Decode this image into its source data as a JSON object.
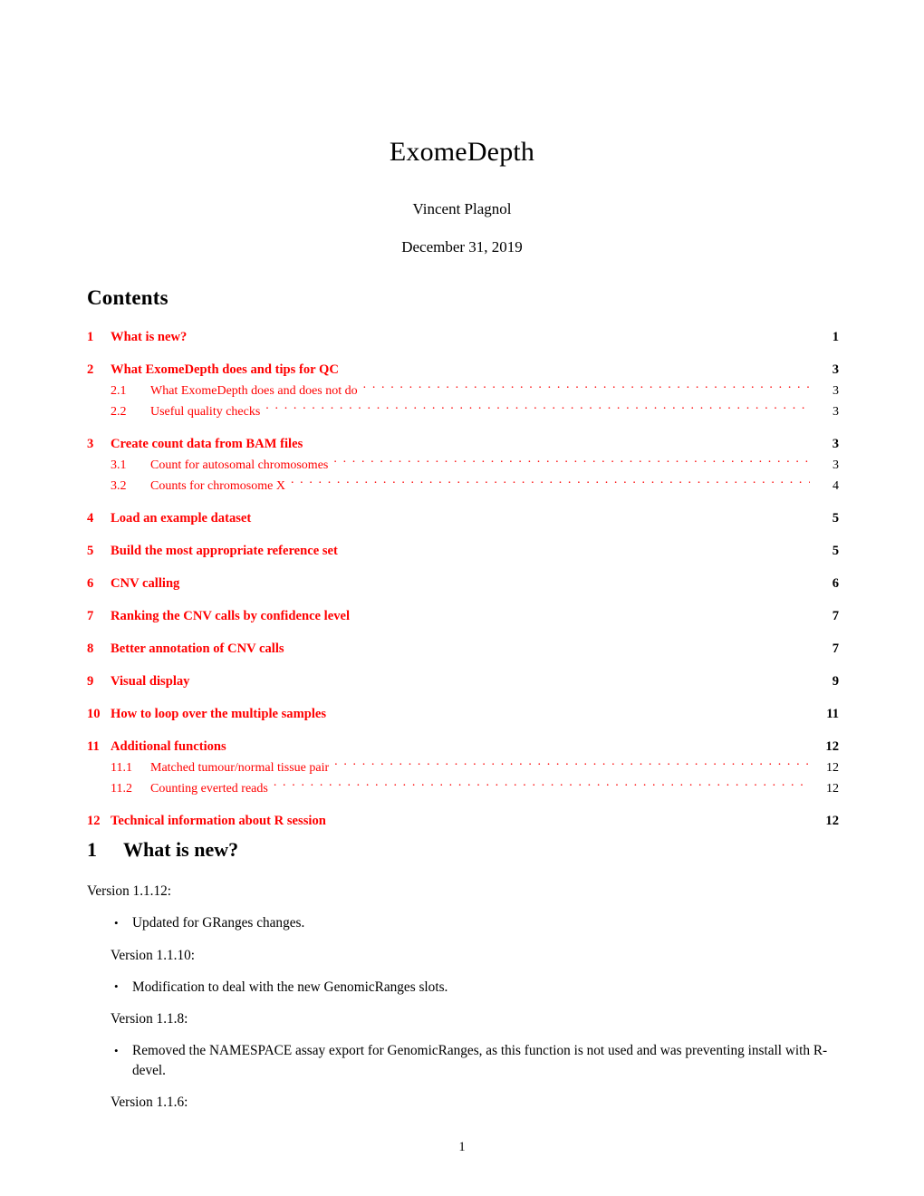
{
  "document": {
    "title": "ExomeDepth",
    "author": "Vincent Plagnol",
    "date": "December 31, 2019",
    "page_number": "1",
    "link_color": "#ff0000",
    "text_color": "#000000"
  },
  "contents": {
    "heading": "Contents",
    "entries": [
      {
        "level": 1,
        "number": "1",
        "label": "What is new?",
        "page": "1"
      },
      {
        "level": 1,
        "number": "2",
        "label": "What ExomeDepth does and tips for QC",
        "page": "3"
      },
      {
        "level": 2,
        "number": "2.1",
        "label": "What ExomeDepth does and does not do",
        "page": "3"
      },
      {
        "level": 2,
        "number": "2.2",
        "label": "Useful quality checks",
        "page": "3"
      },
      {
        "level": 1,
        "number": "3",
        "label": "Create count data from BAM files",
        "page": "3"
      },
      {
        "level": 2,
        "number": "3.1",
        "label": "Count for autosomal chromosomes",
        "page": "3"
      },
      {
        "level": 2,
        "number": "3.2",
        "label": "Counts for chromosome X",
        "page": "4"
      },
      {
        "level": 1,
        "number": "4",
        "label": "Load an example dataset",
        "page": "5"
      },
      {
        "level": 1,
        "number": "5",
        "label": "Build the most appropriate reference set",
        "page": "5"
      },
      {
        "level": 1,
        "number": "6",
        "label": "CNV calling",
        "page": "6"
      },
      {
        "level": 1,
        "number": "7",
        "label": "Ranking the CNV calls by confidence level",
        "page": "7"
      },
      {
        "level": 1,
        "number": "8",
        "label": "Better annotation of CNV calls",
        "page": "7"
      },
      {
        "level": 1,
        "number": "9",
        "label": "Visual display",
        "page": "9"
      },
      {
        "level": 1,
        "number": "10",
        "label": "How to loop over the multiple samples",
        "page": "11"
      },
      {
        "level": 1,
        "number": "11",
        "label": "Additional functions",
        "page": "12"
      },
      {
        "level": 2,
        "number": "11.1",
        "label": "Matched tumour/normal tissue pair",
        "page": "12"
      },
      {
        "level": 2,
        "number": "11.2",
        "label": "Counting everted reads",
        "page": "12"
      },
      {
        "level": 1,
        "number": "12",
        "label": "Technical information about R session",
        "page": "12"
      }
    ]
  },
  "section1": {
    "number": "1",
    "title": "What is new?",
    "blocks": [
      {
        "version": "Version 1.1.12:",
        "bullets": [
          "Updated for GRanges changes."
        ]
      },
      {
        "version": "Version 1.1.10:",
        "bullets": [
          "Modification to deal with the new GenomicRanges slots."
        ]
      },
      {
        "version": "Version 1.1.8:",
        "bullets": [
          "Removed the NAMESPACE assay export for GenomicRanges, as this function is not used and was preventing install with R-devel."
        ]
      },
      {
        "version": "Version 1.1.6:",
        "bullets": []
      }
    ]
  }
}
